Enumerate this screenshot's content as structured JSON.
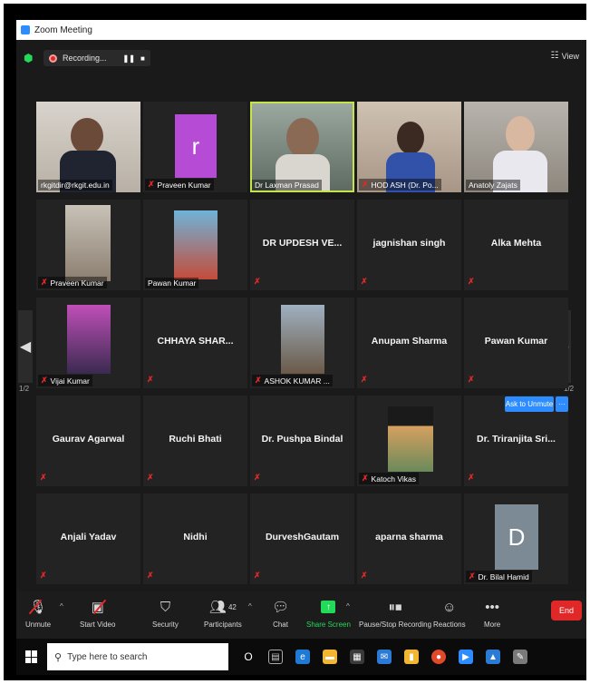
{
  "window": {
    "title": "Zoom Meeting"
  },
  "topbar": {
    "recording_label": "Recording...",
    "pause_glyph": "❚❚",
    "stop_glyph": "■",
    "view_label": "View"
  },
  "pagination": {
    "left_page": "1/2",
    "right_page": "1/2"
  },
  "tiles": [
    {
      "id": "t1",
      "label": "rkgitdir@rkgit.edu.in",
      "kind": "video"
    },
    {
      "id": "t2",
      "label": "Praveen Kumar",
      "kind": "avatar",
      "letter": "r"
    },
    {
      "id": "t3",
      "label": "Dr Laxman Prasad",
      "kind": "video"
    },
    {
      "id": "t4",
      "label": "HOD ASH (Dr. Po...",
      "kind": "video"
    },
    {
      "id": "t5",
      "label": "Anatoly Zajats",
      "kind": "video"
    },
    {
      "id": "t6",
      "label": "Praveen Kumar",
      "kind": "photo"
    },
    {
      "id": "t7",
      "label": "Pawan Kumar",
      "kind": "photo"
    },
    {
      "id": "t8",
      "label": "DR UPDESH VE...",
      "kind": "name"
    },
    {
      "id": "t9",
      "label": "jagnishan singh",
      "kind": "name"
    },
    {
      "id": "t10",
      "label": "Alka Mehta",
      "kind": "name"
    },
    {
      "id": "t11",
      "label": "Vijai Kumar",
      "kind": "photo"
    },
    {
      "id": "t12",
      "label": "CHHAYA SHAR...",
      "kind": "name"
    },
    {
      "id": "t13",
      "label": "ASHOK KUMAR ...",
      "kind": "photo"
    },
    {
      "id": "t14",
      "label": "Anupam Sharma",
      "kind": "name"
    },
    {
      "id": "t15",
      "label": "Pawan Kumar",
      "kind": "name"
    },
    {
      "id": "t16",
      "label": "Gaurav Agarwal",
      "kind": "name"
    },
    {
      "id": "t17",
      "label": "Ruchi Bhati",
      "kind": "name"
    },
    {
      "id": "t18",
      "label": "Dr. Pushpa Bindal",
      "kind": "name"
    },
    {
      "id": "t19",
      "label": "Katoch Vikas",
      "kind": "photo"
    },
    {
      "id": "t20",
      "label": "Dr. Triranjita Sri...",
      "kind": "name"
    },
    {
      "id": "t21",
      "label": "Anjali Yadav",
      "kind": "name"
    },
    {
      "id": "t22",
      "label": "Nidhi",
      "kind": "name"
    },
    {
      "id": "t23",
      "label": "DurveshGautam",
      "kind": "name"
    },
    {
      "id": "t24",
      "label": "aparna sharma",
      "kind": "name"
    },
    {
      "id": "t25",
      "label": "Dr. Bilal Hamid",
      "kind": "avatar",
      "letter": "D"
    }
  ],
  "ask_to_unmute": "Ask to Unmute",
  "more_glyph": "···",
  "toolbar": {
    "unmute": "Unmute",
    "start_video": "Start Video",
    "security": "Security",
    "participants": "Participants",
    "participants_count": "42",
    "chat": "Chat",
    "share_screen": "Share Screen",
    "pause_recording": "Pause/Stop Recording",
    "reactions": "Reactions",
    "more": "More",
    "end": "End"
  },
  "taskbar": {
    "search_placeholder": "Type here to search",
    "cortana": "O"
  },
  "colors": {
    "accent_blue": "#2d8cff",
    "end_red": "#e02828",
    "share_green": "#23d959",
    "active_speaker": "#c7e34a"
  }
}
